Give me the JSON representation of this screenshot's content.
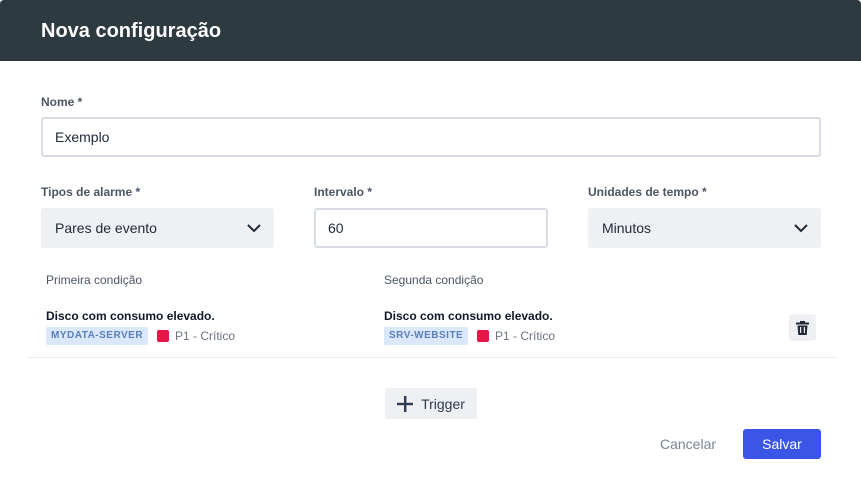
{
  "dialog": {
    "title": "Nova configuração"
  },
  "form": {
    "name": {
      "label": "Nome *",
      "value": "Exemplo"
    },
    "alarm_type": {
      "label": "Tipos de alarme *",
      "value": "Pares de evento"
    },
    "interval": {
      "label": "Intervalo *",
      "value": "60"
    },
    "time_unit": {
      "label": "Unidades de tempo *",
      "value": "Minutos"
    }
  },
  "conditions": {
    "first_header": "Primeira condição",
    "second_header": "Segunda condição",
    "rows": [
      {
        "first": {
          "title": "Disco com consumo elevado.",
          "host": "MYDATA-SERVER",
          "severity": "P1 - Crítico",
          "severity_color": "#e8174a"
        },
        "second": {
          "title": "Disco com consumo elevado.",
          "host": "SRV-WEBSITE",
          "severity": "P1 - Crítico",
          "severity_color": "#e8174a"
        },
        "delete_icon": "trash-icon"
      }
    ]
  },
  "actions": {
    "add_trigger_label": "Trigger",
    "add_trigger_icon": "plus-icon",
    "cancel_label": "Cancelar",
    "save_label": "Salvar"
  },
  "colors": {
    "header_bg": "#2d3a3f",
    "primary": "#3b55e6",
    "critical": "#e8174a"
  }
}
